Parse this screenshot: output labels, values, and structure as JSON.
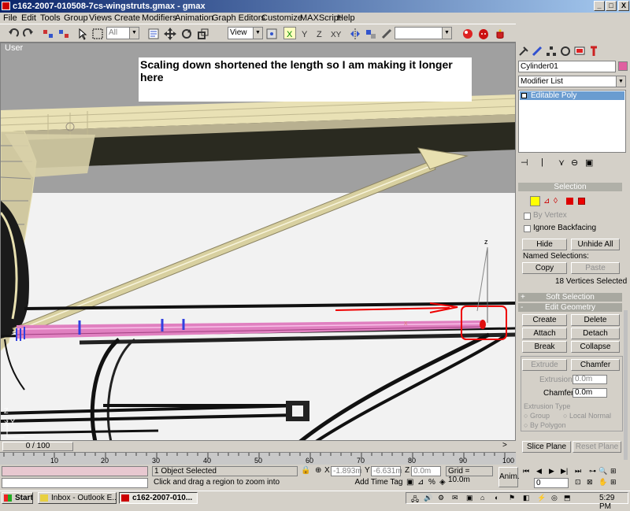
{
  "window": {
    "title": "c162-2007-010508-7cs-wingstruts.gmax - gmax",
    "minimize": "_",
    "maximize": "□",
    "close": "X"
  },
  "menu": [
    "File",
    "Edit",
    "Tools",
    "Group",
    "Views",
    "Create",
    "Modifiers",
    "Animation",
    "Graph Editors",
    "Customize",
    "MAXScript",
    "Help"
  ],
  "toolbar": {
    "selection_filter": "All",
    "reference_coord": "View",
    "named_selection": ""
  },
  "viewport": {
    "label": "User",
    "annotation": "Scaling down shortened the length so I am making it longer here",
    "axis_z": "z",
    "gizmo_z": "Z",
    "gizmo_y": "Y",
    "gizmo_x": "X"
  },
  "panel": {
    "object_name": "Cylinder01",
    "object_color": "#e060a0",
    "modifier_list": "Modifier List",
    "stack_item": "Editable Poly",
    "selection": {
      "header": "Selection",
      "by_vertex": "By Vertex",
      "ignore_backfacing": "Ignore Backfacing",
      "hide": "Hide",
      "unhide_all": "Unhide All",
      "named_selections": "Named Selections:",
      "copy": "Copy",
      "paste": "Paste",
      "status": "18 Vertices Selected"
    },
    "soft_selection": {
      "toggle": "+",
      "header": "Soft Selection"
    },
    "edit_geometry": {
      "toggle": "-",
      "header": "Edit Geometry",
      "create": "Create",
      "delete": "Delete",
      "attach": "Attach",
      "detach": "Detach",
      "break": "Break",
      "collapse": "Collapse",
      "extrude": "Extrude",
      "chamfer": "Chamfer",
      "extrusion_label": "Extrusion",
      "extrusion_value": "0.0m",
      "chamfer_label": "Chamfer",
      "chamfer_value": "0.0m",
      "extrusion_type": "Extrusion Type",
      "group": "Group",
      "local_normal": "Local Normal",
      "by_polygon": "By Polygon",
      "slice_plane": "Slice Plane",
      "reset_plane": "Reset Plane"
    }
  },
  "timeline": {
    "frame": "0 / 100",
    "ticks": [
      "10",
      "20",
      "30",
      "40",
      "50",
      "60",
      "70",
      "80",
      "90",
      "100"
    ]
  },
  "status": {
    "selected": "1 Object Selected",
    "prompt": "Click and drag a region to zoom into",
    "x_label": "X",
    "x_value": "-1.893m",
    "y_label": "Y",
    "y_value": "-6.631m",
    "z_label": "Z",
    "z_value": "0.0m",
    "grid": "Grid = 10.0m",
    "add_time_tag": "Add Time Tag",
    "anim": "Anim.",
    "frame_value": "0"
  },
  "taskbar": {
    "start": "Start",
    "task1": "Inbox - Outlook E...",
    "task2": "c162-2007-010...",
    "clock": "5:29 PM"
  },
  "colors": {
    "selection_highlight": "#e080c0",
    "annotation_red": "#ee0000",
    "wing": "#e8e0b0"
  }
}
